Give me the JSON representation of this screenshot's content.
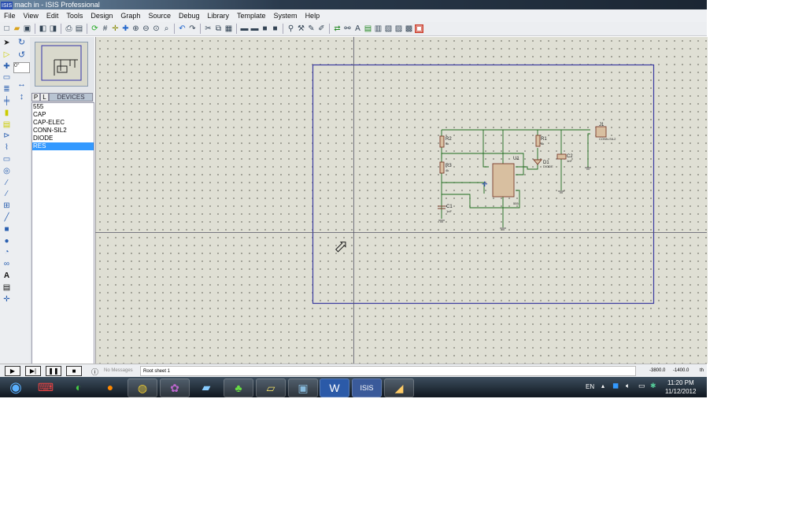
{
  "window": {
    "title": "mach in - ISIS Professional",
    "logo": "ISIS"
  },
  "menu": [
    "File",
    "View",
    "Edit",
    "Tools",
    "Design",
    "Graph",
    "Source",
    "Debug",
    "Library",
    "Template",
    "System",
    "Help"
  ],
  "panel": {
    "angle": "0°",
    "tab_p": "P",
    "tab_l": "L",
    "tab_devices": "DEVICES",
    "devices": [
      "555",
      "CAP",
      "CAP-ELEC",
      "CONN-SIL2",
      "DIODE",
      "RES"
    ],
    "selected": "RES"
  },
  "schematic": {
    "parts": [
      {
        "ref": "R2",
        "value": "4k"
      },
      {
        "ref": "R3",
        "value": "4k"
      },
      {
        "ref": "C1",
        "value": "1nF"
      },
      {
        "ref": "U1",
        "value": "555"
      },
      {
        "ref": "R1",
        "value": "4k"
      },
      {
        "ref": "D1",
        "value": "DIODE"
      },
      {
        "ref": "C2",
        "value": "1nF"
      },
      {
        "ref": "J1",
        "value": "CONN-SIL2"
      }
    ]
  },
  "status": {
    "messages": "No Messages",
    "sheet": "Root sheet 1",
    "x": "-3800.0",
    "y": "-1400.0",
    "units": "th"
  },
  "taskbar": {
    "language": "EN",
    "time": "11:20 PM",
    "date": "11/12/2012"
  }
}
